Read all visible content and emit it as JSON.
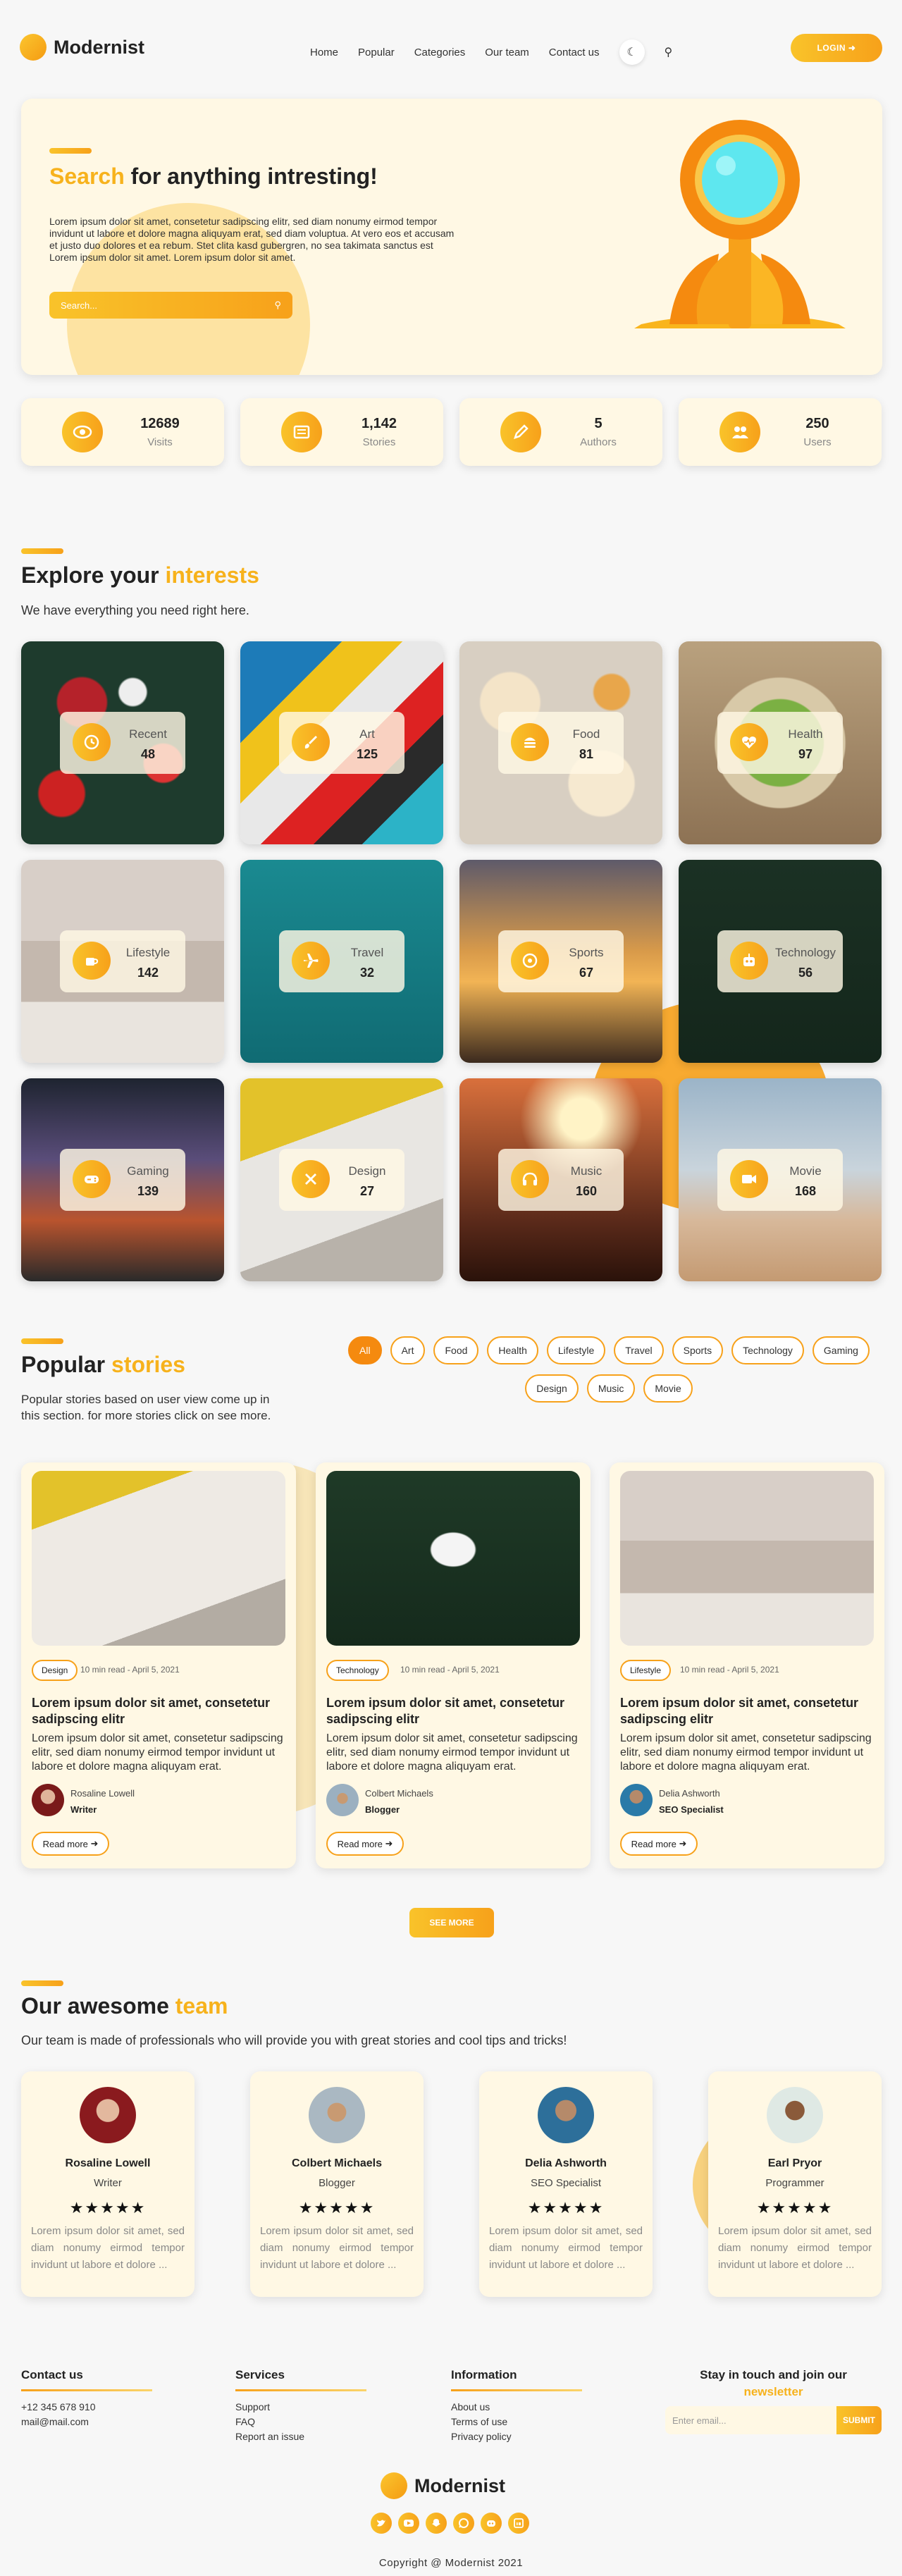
{
  "header": {
    "logo": "Modernist",
    "nav": [
      "Home",
      "Popular",
      "Categories",
      "Our team",
      "Contact us"
    ],
    "login": "LOGIN"
  },
  "hero": {
    "title_highlight": "Search",
    "title_rest": " for anything intresting!",
    "text": "Lorem ipsum dolor sit amet, consetetur sadipscing elitr, sed diam nonumy eirmod tempor invidunt ut labore et dolore magna aliquyam erat, sed diam voluptua. At vero eos et accusam et justo duo dolores et ea rebum. Stet clita kasd gubergren, no sea takimata sanctus est Lorem ipsum dolor sit amet. Lorem ipsum dolor sit amet.",
    "search_placeholder": "Search..."
  },
  "stats": [
    {
      "value": "12689",
      "label": "Visits",
      "icon": "eye-icon"
    },
    {
      "value": "1,142",
      "label": "Stories",
      "icon": "newspaper-icon"
    },
    {
      "value": "5",
      "label": "Authors",
      "icon": "pen-icon"
    },
    {
      "value": "250",
      "label": "Users",
      "icon": "users-icon"
    }
  ],
  "interests": {
    "title": "Explore your",
    "title_highlight": "interests",
    "subtitle": "We have everything you need right here.",
    "items": [
      {
        "name": "Recent",
        "count": "48",
        "icon": "history-icon"
      },
      {
        "name": "Art",
        "count": "125",
        "icon": "brush-icon"
      },
      {
        "name": "Food",
        "count": "81",
        "icon": "burger-icon"
      },
      {
        "name": "Health",
        "count": "97",
        "icon": "heartbeat-icon"
      },
      {
        "name": "Lifestyle",
        "count": "142",
        "icon": "coffee-icon"
      },
      {
        "name": "Travel",
        "count": "32",
        "icon": "plane-icon"
      },
      {
        "name": "Sports",
        "count": "67",
        "icon": "ball-icon"
      },
      {
        "name": "Technology",
        "count": "56",
        "icon": "robot-icon"
      },
      {
        "name": "Gaming",
        "count": "139",
        "icon": "gamepad-icon"
      },
      {
        "name": "Design",
        "count": "27",
        "icon": "tools-icon"
      },
      {
        "name": "Music",
        "count": "160",
        "icon": "headphones-icon"
      },
      {
        "name": "Movie",
        "count": "168",
        "icon": "video-icon"
      }
    ]
  },
  "popular": {
    "title": "Popular",
    "title_highlight": "stories",
    "subtitle": "Popular stories based on user view come up in this section. for more stories click on see more.",
    "filters": [
      "All",
      "Art",
      "Food",
      "Health",
      "Lifestyle",
      "Travel",
      "Sports",
      "Technology",
      "Gaming",
      "Design",
      "Music",
      "Movie"
    ],
    "stories": [
      {
        "tag": "Design",
        "meta": "10 min read - April 5, 2021",
        "title": "Lorem ipsum dolor sit amet, consetetur sadipscing elitr",
        "body": "Lorem ipsum dolor sit amet, consetetur sadipscing elitr, sed diam nonumy eirmod tempor invidunt ut labore et dolore magna aliquyam erat.",
        "author": "Rosaline Lowell",
        "role": "Writer",
        "read_more": "Read more"
      },
      {
        "tag": "Technology",
        "meta": "10 min read - April 5, 2021",
        "title": "Lorem ipsum dolor sit amet, consetetur sadipscing elitr",
        "body": "Lorem ipsum dolor sit amet, consetetur sadipscing elitr, sed diam nonumy eirmod tempor invidunt ut labore et dolore magna aliquyam erat.",
        "author": "Colbert Michaels",
        "role": "Blogger",
        "read_more": "Read more"
      },
      {
        "tag": "Lifestyle",
        "meta": "10 min read - April 5, 2021",
        "title": "Lorem ipsum dolor sit amet, consetetur sadipscing elitr",
        "body": "Lorem ipsum dolor sit amet, consetetur sadipscing elitr, sed diam nonumy eirmod tempor invidunt ut labore et dolore magna aliquyam erat.",
        "author": "Delia Ashworth",
        "role": "SEO Specialist",
        "read_more": "Read more"
      }
    ],
    "see_more": "SEE MORE"
  },
  "team": {
    "title": "Our awesome",
    "title_highlight": "team",
    "subtitle": "Our team is made of professionals who will provide you with great stories and cool tips and tricks!",
    "members": [
      {
        "name": "Rosaline Lowell",
        "role": "Writer",
        "stars": "★★★★★",
        "bio": "Lorem ipsum dolor sit amet, sed diam nonumy eirmod tempor invidunt ut labore et dolore ..."
      },
      {
        "name": "Colbert Michaels",
        "role": "Blogger",
        "stars": "★★★★★",
        "bio": "Lorem ipsum dolor sit amet, sed diam nonumy eirmod tempor invidunt ut labore et dolore ..."
      },
      {
        "name": "Delia Ashworth",
        "role": "SEO Specialist",
        "stars": "★★★★★",
        "bio": "Lorem ipsum dolor sit amet, sed diam nonumy eirmod tempor invidunt ut labore et dolore ..."
      },
      {
        "name": "Earl Pryor",
        "role": "Programmer",
        "stars": "★★★★★",
        "bio": "Lorem ipsum dolor sit amet, sed diam nonumy eirmod tempor invidunt ut labore et dolore ..."
      }
    ]
  },
  "footer": {
    "contact": {
      "title": "Contact us",
      "lines": [
        "+12 345 678 910",
        "mail@mail.com"
      ]
    },
    "services": {
      "title": "Services",
      "lines": [
        "Support",
        "FAQ",
        "Report an issue"
      ]
    },
    "information": {
      "title": "Information",
      "lines": [
        "About us",
        "Terms of use",
        "Privacy policy"
      ]
    },
    "newsletter": {
      "title": "Stay in touch and join our",
      "title_highlight": "newsletter",
      "placeholder": "Enter email...",
      "submit": "SUBMIT"
    },
    "logo": "Modernist",
    "socials": [
      "twitter-icon",
      "youtube-icon",
      "snapchat-icon",
      "whatsapp-icon",
      "discord-icon",
      "linkedin-icon"
    ],
    "copyright": "Copyright @ Modernist 2021"
  },
  "colors": {
    "accent": "#f7b21c",
    "accent_dark": "#f58a0f",
    "card_bg": "#fff8e4",
    "page_bg": "#f7f7f7"
  }
}
